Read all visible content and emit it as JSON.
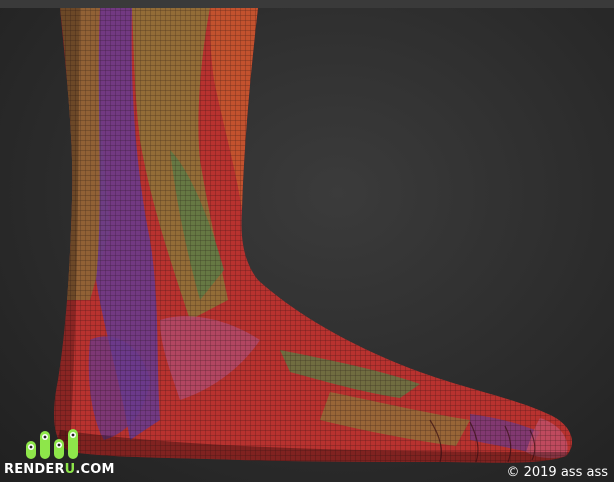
{
  "logo": {
    "text_main": "RENDER",
    "text_accent": "U",
    "text_suffix": ".COM",
    "brand_color": "#8ee64a"
  },
  "copyright": {
    "text": "© 2019 ass ass"
  },
  "viewport": {
    "subject": "foot-mesh-render",
    "colors": {
      "red": "#b8322f",
      "purple": "#6a3a8c",
      "olive": "#8a7a3a",
      "green": "#5e7a45",
      "pink": "#b04a6a",
      "orange": "#c65a2e"
    }
  }
}
